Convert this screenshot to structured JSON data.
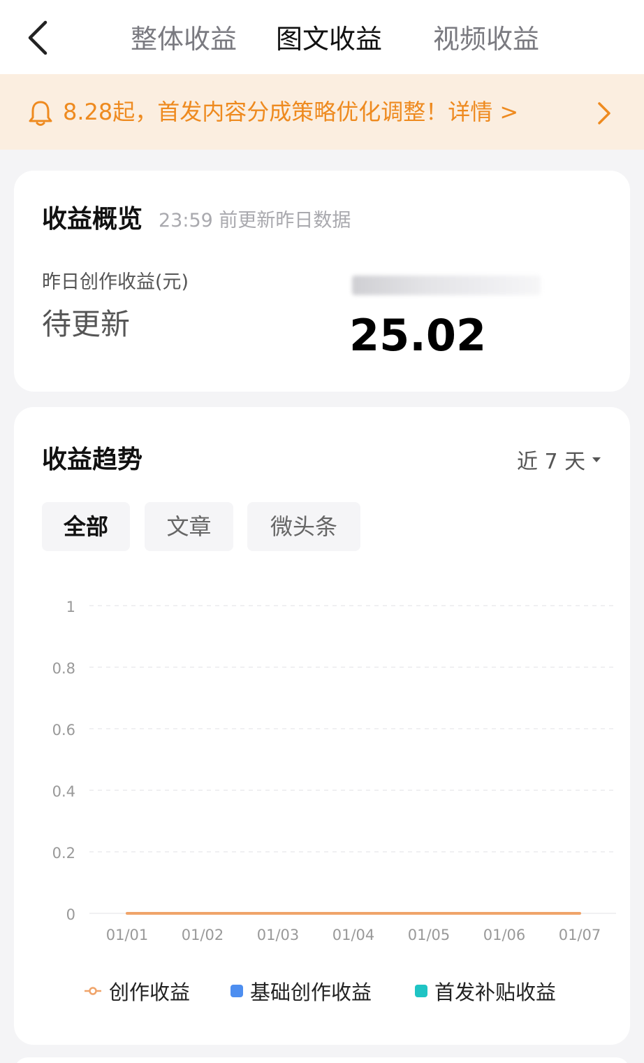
{
  "nav": {
    "tabs": [
      {
        "label": "整体收益",
        "active": false
      },
      {
        "label": "图文收益",
        "active": true
      },
      {
        "label": "视频收益",
        "active": false
      }
    ]
  },
  "banner": {
    "text": "8.28起，首发内容分成策略优化调整！详情 >"
  },
  "overview": {
    "title": "收益概览",
    "subtitle": "23:59 前更新昨日数据",
    "yesterday_label": "昨日创作收益(元)",
    "yesterday_value": "待更新",
    "total_value": "25.02"
  },
  "trend": {
    "title": "收益趋势",
    "range_label": "近 7 天",
    "filters": [
      {
        "label": "全部",
        "active": true
      },
      {
        "label": "文章",
        "active": false
      },
      {
        "label": "微头条",
        "active": false
      }
    ]
  },
  "colors": {
    "accent_orange": "#ee8a1f",
    "series_create": "#f0a46a",
    "series_basic": "#4d8ef0",
    "series_first": "#1fc4c4"
  },
  "chart_data": {
    "type": "line",
    "x": [
      "01/01",
      "01/02",
      "01/03",
      "01/04",
      "01/05",
      "01/06",
      "01/07"
    ],
    "yticks": [
      "1",
      "0.8",
      "0.6",
      "0.4",
      "0.2",
      "0"
    ],
    "ylim": [
      0,
      1
    ],
    "grid": true,
    "legend_position": "bottom",
    "series": [
      {
        "name": "创作收益",
        "values": [
          0,
          0,
          0,
          0,
          0,
          0,
          0
        ]
      },
      {
        "name": "基础创作收益",
        "values": [
          0,
          0,
          0,
          0,
          0,
          0,
          0
        ]
      },
      {
        "name": "首发补贴收益",
        "values": [
          0,
          0,
          0,
          0,
          0,
          0,
          0
        ]
      }
    ]
  }
}
